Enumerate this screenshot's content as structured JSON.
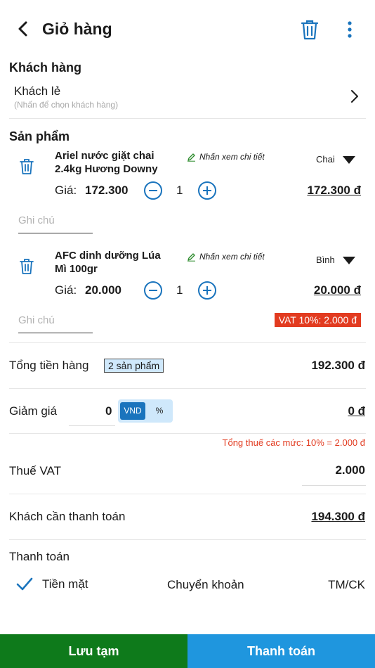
{
  "header": {
    "title": "Giỏ hàng"
  },
  "customer": {
    "section_title": "Khách hàng",
    "name": "Khách lẻ",
    "hint": "(Nhấn để chọn khách hàng)"
  },
  "products": {
    "section_title": "Sản phẩm",
    "detail_link": "Nhấn xem chi tiết",
    "price_label": "Giá:",
    "note_placeholder": "Ghi chú",
    "items": [
      {
        "name_line1": "Ariel nước giặt chai",
        "name_line2": "2.4kg Hương Downy",
        "unit": "Chai",
        "price": "172.300",
        "qty": "1",
        "total": "172.300 đ"
      },
      {
        "name_line1": "AFC dinh dưỡng Lúa",
        "name_line2": "Mì 100gr",
        "unit": "Bình",
        "price": "20.000",
        "qty": "1",
        "total": "20.000 đ",
        "vat_badge": "VAT 10%: 2.000 đ"
      }
    ]
  },
  "summary": {
    "subtotal_label": "Tổng tiền hàng",
    "subtotal_badge": "2 sản phẩm",
    "subtotal_value": "192.300 đ",
    "discount_label": "Giảm giá",
    "discount_input": "0",
    "discount_mode_vnd": "VND",
    "discount_mode_pct": "%",
    "discount_value": "0 đ",
    "tax_note": "Tổng thuế các mức: 10% = 2.000 đ",
    "vat_label": "Thuế VAT",
    "vat_value": "2.000",
    "due_label": "Khách cần thanh toán",
    "due_value": "194.300 đ"
  },
  "payment": {
    "section_title": "Thanh toán",
    "options": [
      "Tiền mặt",
      "Chuyển khoản",
      "TM/CK"
    ],
    "selected": "Tiền mặt"
  },
  "footer": {
    "save_draft": "Lưu tạm",
    "checkout": "Thanh toán"
  },
  "colors": {
    "accent": "#1a74bd",
    "save_green": "#0e7a1b",
    "checkout_blue": "#1f96de",
    "vat_red": "#e23b20"
  }
}
